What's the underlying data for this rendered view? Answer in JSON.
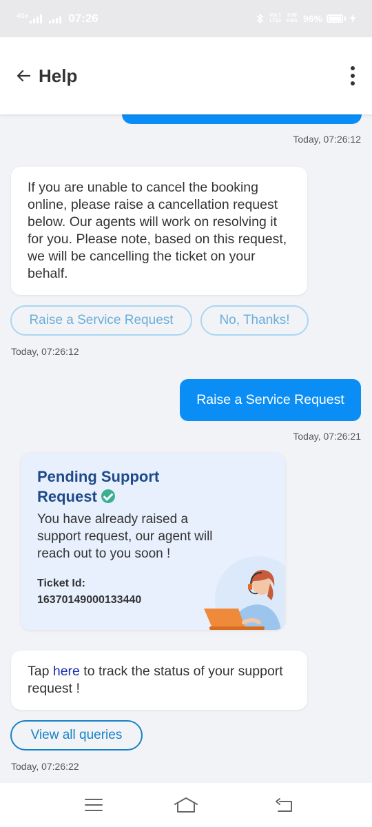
{
  "status_bar": {
    "network_label": "4G+",
    "time": "07:26",
    "volte_top": "Vo) 1",
    "volte_bottom": "LTE2",
    "speed_top": "0.00",
    "speed_bottom": "KB/s",
    "battery": "96%"
  },
  "header": {
    "title": "Help"
  },
  "messages": {
    "ts_top": "Today, 07:26:12",
    "bot_cancel_text": "If you are unable to cancel the booking online, please raise a cancellation request below. Our agents will work on resolving it for you. Please note, based on this request, we will be cancelling the ticket on your behalf.",
    "chip_raise": "Raise a Service Request",
    "chip_no": "No, Thanks!",
    "ts_bot_1": "Today, 07:26:12",
    "user_reply": "Raise a Service Request",
    "ts_user_reply": "Today, 07:26:21",
    "pending_title": "Pending Support Request",
    "pending_msg": "You have already raised a support request, our agent will reach out to you soon !",
    "ticket_label": "Ticket Id:",
    "ticket_id": "16370149000133440",
    "tap_prefix": "Tap ",
    "tap_link": "here",
    "tap_suffix": " to track the status of your support request !",
    "view_all": "View all queries",
    "ts_last": "Today, 07:26:22"
  },
  "colors": {
    "accent_blue": "#0a8ef5",
    "card_title": "#1f4a8a",
    "check_green": "#3bb08f"
  }
}
